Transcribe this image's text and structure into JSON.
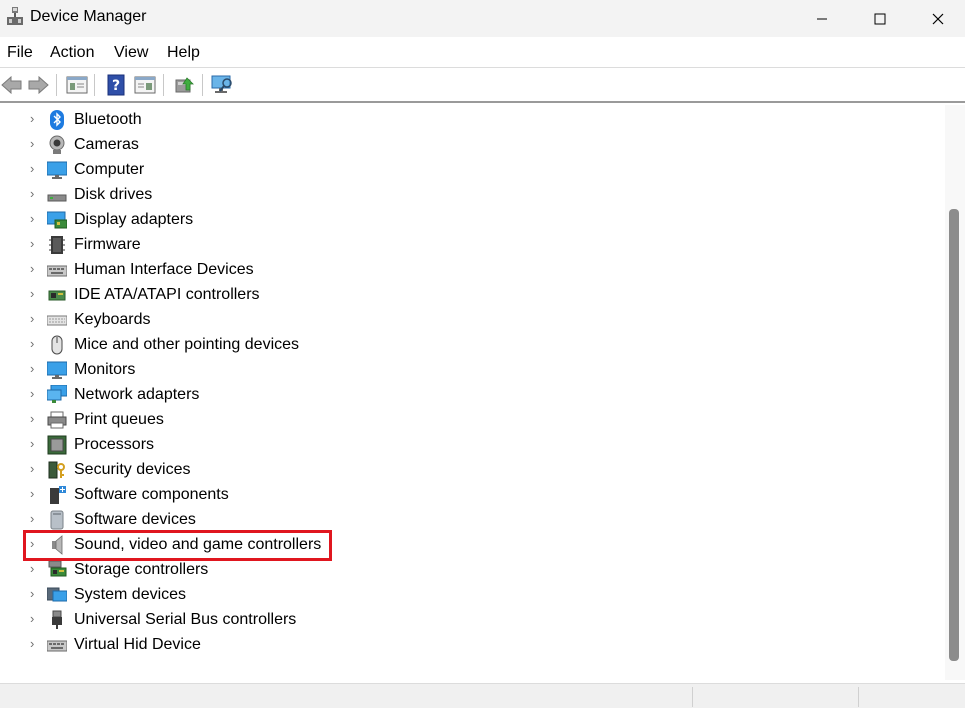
{
  "window": {
    "title": "Device Manager"
  },
  "menu": [
    "File",
    "Action",
    "View",
    "Help"
  ],
  "toolbar": {
    "buttons": [
      "back-arrow-icon",
      "forward-arrow-icon",
      "properties-icon",
      "help-icon",
      "show-hide-icon",
      "update-driver-icon",
      "scan-hardware-icon"
    ]
  },
  "tree": {
    "items": [
      {
        "label": "Bluetooth",
        "icon": "bluetooth-icon"
      },
      {
        "label": "Cameras",
        "icon": "camera-icon"
      },
      {
        "label": "Computer",
        "icon": "computer-icon"
      },
      {
        "label": "Disk drives",
        "icon": "disk-drive-icon"
      },
      {
        "label": "Display adapters",
        "icon": "display-adapter-icon"
      },
      {
        "label": "Firmware",
        "icon": "firmware-icon"
      },
      {
        "label": "Human Interface Devices",
        "icon": "hid-icon"
      },
      {
        "label": "IDE ATA/ATAPI controllers",
        "icon": "ide-controller-icon"
      },
      {
        "label": "Keyboards",
        "icon": "keyboard-icon"
      },
      {
        "label": "Mice and other pointing devices",
        "icon": "mouse-icon"
      },
      {
        "label": "Monitors",
        "icon": "monitor-icon"
      },
      {
        "label": "Network adapters",
        "icon": "network-adapter-icon"
      },
      {
        "label": "Print queues",
        "icon": "printer-icon"
      },
      {
        "label": "Processors",
        "icon": "processor-icon"
      },
      {
        "label": "Security devices",
        "icon": "security-device-icon"
      },
      {
        "label": "Software components",
        "icon": "software-component-icon"
      },
      {
        "label": "Software devices",
        "icon": "software-device-icon"
      },
      {
        "label": "Sound, video and game controllers",
        "icon": "speaker-icon"
      },
      {
        "label": "Storage controllers",
        "icon": "storage-controller-icon"
      },
      {
        "label": "System devices",
        "icon": "system-device-icon"
      },
      {
        "label": "Universal Serial Bus controllers",
        "icon": "usb-icon"
      },
      {
        "label": "Virtual Hid Device",
        "icon": "hid-icon"
      }
    ]
  },
  "colors": {
    "highlight_border": "#e0161f",
    "accent_blue": "#0078d4"
  }
}
